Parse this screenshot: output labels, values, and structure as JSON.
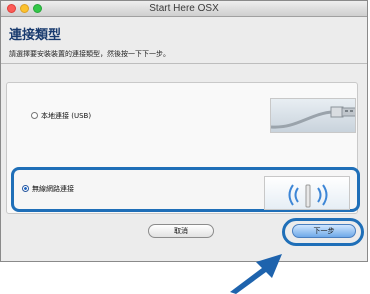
{
  "window": {
    "title": "Start Here OSX"
  },
  "page": {
    "heading": "連接類型",
    "instruction": "請選擇要安裝裝置的連接類型，然後按一下下一步。"
  },
  "options": [
    {
      "label": "本地連接 (USB)",
      "selected": false,
      "image_icon": "usb-cable-icon"
    },
    {
      "label": "無線網路連接",
      "selected": true,
      "image_icon": "wireless-signal-icon"
    }
  ],
  "buttons": {
    "cancel": "取消",
    "next": "下一步"
  },
  "colors": {
    "highlight": "#1f6fb8",
    "heading": "#183a6e",
    "pointer_arrow": "#1e63ad"
  },
  "icons": {
    "pointer": "pointer-arrow-icon"
  }
}
